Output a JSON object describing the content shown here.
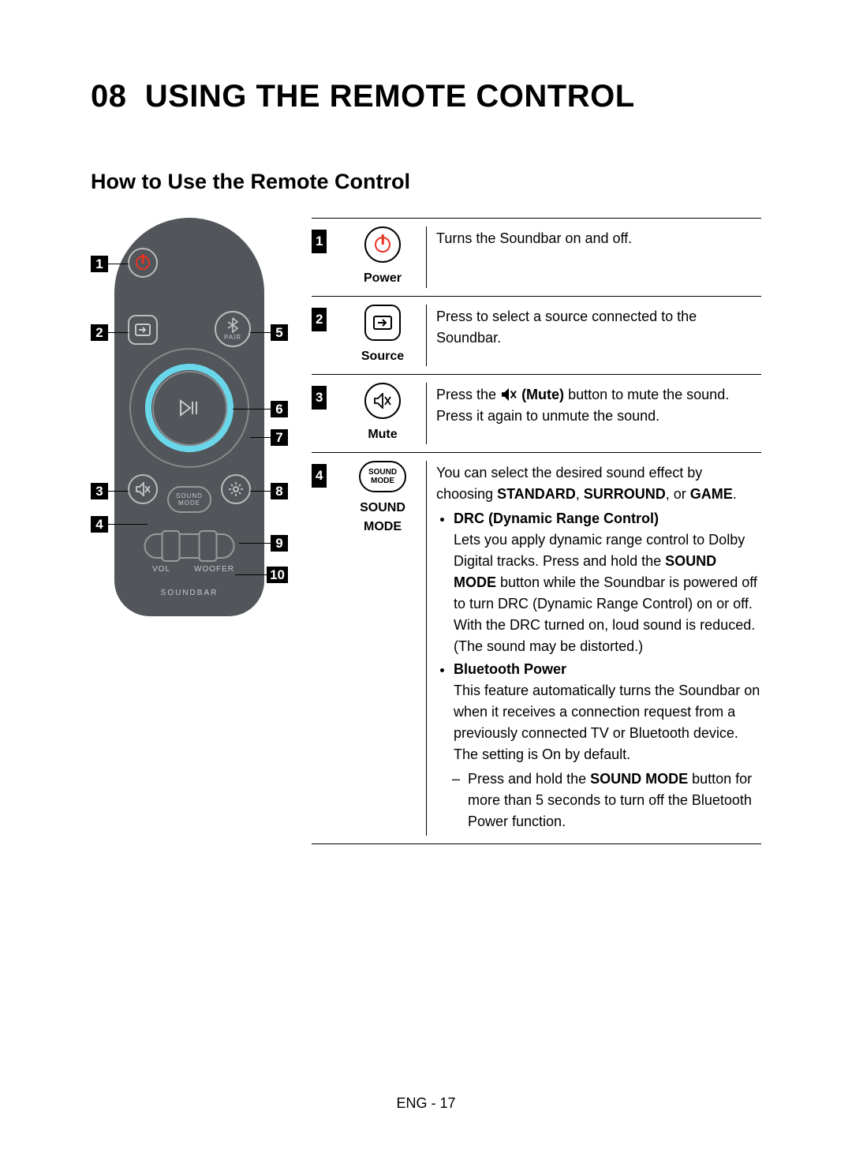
{
  "section_number": "08",
  "section_title": "USING THE REMOTE CONTROL",
  "subsection_title": "How to Use the Remote Control",
  "remote": {
    "pair_label": "PAIR",
    "sound_mode_label_1": "SOUND",
    "sound_mode_label_2": "MODE",
    "vol_label": "VOL",
    "woofer_label": "WOOFER",
    "brand_label": "SOUNDBAR",
    "callouts": {
      "c1": "1",
      "c2": "2",
      "c3": "3",
      "c4": "4",
      "c5": "5",
      "c6": "6",
      "c7": "7",
      "c8": "8",
      "c9": "9",
      "c10": "10"
    }
  },
  "table": {
    "rows": [
      {
        "num": "1",
        "icon_label": "Power",
        "desc_plain": "Turns the Soundbar on and off."
      },
      {
        "num": "2",
        "icon_label": "Source",
        "desc_plain": "Press to select a source connected to the Soundbar."
      },
      {
        "num": "3",
        "icon_label": "Mute",
        "desc_pre": "Press the ",
        "desc_bold1": "(Mute)",
        "desc_post": " button to mute the sound. Press it again to unmute the sound."
      },
      {
        "num": "4",
        "icon_label": "SOUND MODE",
        "pill_line1": "SOUND",
        "pill_line2": "MODE",
        "intro_pre": "You can select the desired sound effect by choosing ",
        "intro_b1": "STANDARD",
        "intro_sep1": ", ",
        "intro_b2": "SURROUND",
        "intro_sep2": ", or ",
        "intro_b3": "GAME",
        "intro_post": ".",
        "b1_title": "DRC (Dynamic Range Control)",
        "b1_text_pre": "Lets you apply dynamic range control to Dolby Digital tracks. Press and hold the ",
        "b1_text_bold": "SOUND MODE",
        "b1_text_post": " button while the Soundbar is powered off to turn DRC (Dynamic Range Control) on or off. With the DRC turned on, loud sound is reduced. (The sound may be distorted.)",
        "b2_title": "Bluetooth Power",
        "b2_text": "This feature automatically turns the Soundbar on when it receives a connection request from a previously connected TV or Bluetooth device. The setting is On by default.",
        "b2_sub_pre": "Press and hold the ",
        "b2_sub_bold": "SOUND MODE",
        "b2_sub_post": " button for more than 5 seconds to turn off the Bluetooth Power function."
      }
    ]
  },
  "footer": "ENG - 17"
}
